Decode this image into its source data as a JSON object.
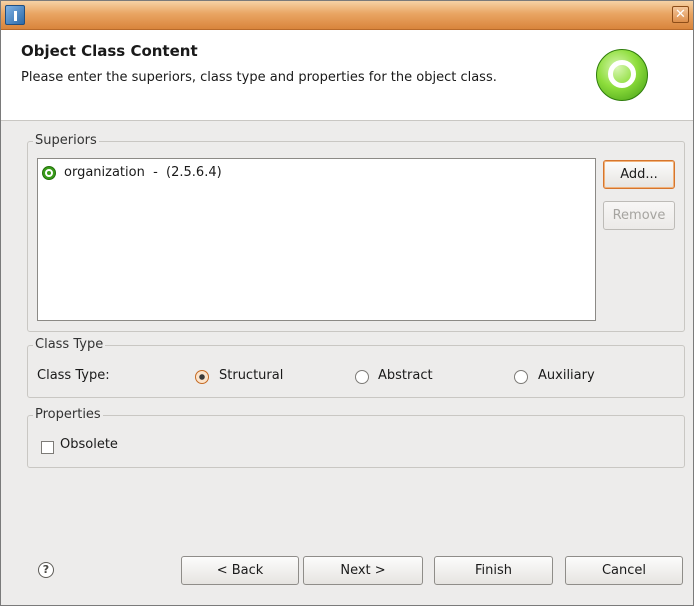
{
  "window": {
    "close_glyph": "✕",
    "app_icon": "eclipse-wizard-icon"
  },
  "header": {
    "title": "Object Class Content",
    "description": "Please enter the superiors, class type  and properties for the object class.",
    "banner_icon": "object-class-icon"
  },
  "superiors": {
    "group_label": "Superiors",
    "items": [
      {
        "label": "organization  -  (2.5.6.4)",
        "icon": "object-class-icon"
      }
    ],
    "add_label": "Add...",
    "remove_label": "Remove"
  },
  "class_type": {
    "group_label": "Class Type",
    "field_label": "Class Type:",
    "options": [
      "Structural",
      "Abstract",
      "Auxiliary"
    ],
    "selected": "Structural"
  },
  "properties": {
    "group_label": "Properties",
    "obsolete_label": "Obsolete",
    "obsolete_checked": false
  },
  "footer": {
    "help_glyph": "?",
    "back_label": "< Back",
    "next_label": "Next >",
    "finish_label": "Finish",
    "cancel_label": "Cancel"
  },
  "colors": {
    "titlebar": "#e9a563",
    "focus_border": "#d6752d",
    "icon_green": "#3a9d1a"
  }
}
